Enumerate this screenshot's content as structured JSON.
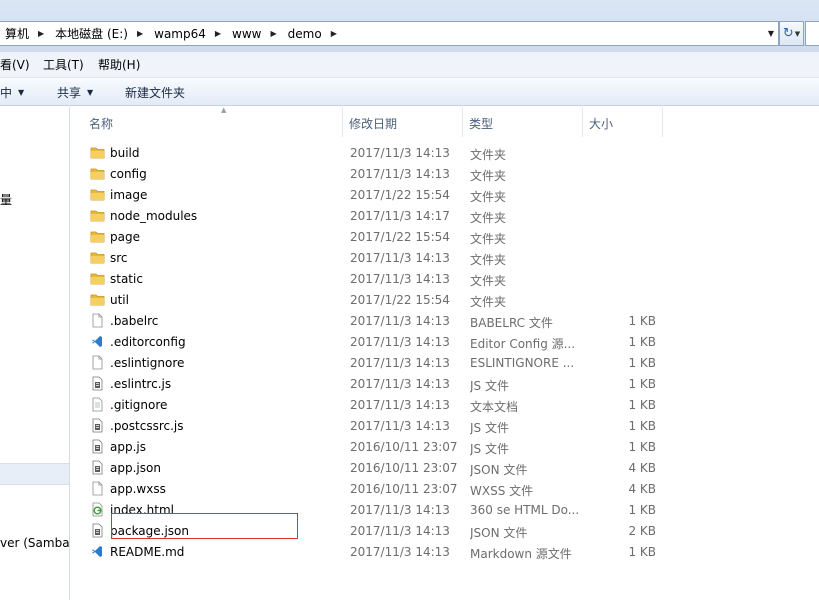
{
  "address_bar": {
    "crumbs": [
      "算机",
      "本地磁盘 (E:)",
      "wamp64",
      "www",
      "demo"
    ]
  },
  "menu": {
    "items": [
      "看(V)",
      "工具(T)",
      "帮助(H)"
    ]
  },
  "commands": {
    "include_in_library": "中",
    "share": "共享",
    "new_folder": "新建文件夹"
  },
  "nav": {
    "item_mid": "量",
    "item_network": "ver (Samba S"
  },
  "columns": {
    "name": "名称",
    "date": "修改日期",
    "type": "类型",
    "size": "大小"
  },
  "files": [
    {
      "name": "build",
      "date": "2017/11/3 14:13",
      "type": "文件夹",
      "size": "",
      "icon": "folder-icon"
    },
    {
      "name": "config",
      "date": "2017/11/3 14:13",
      "type": "文件夹",
      "size": "",
      "icon": "folder-icon"
    },
    {
      "name": "image",
      "date": "2017/1/22 15:54",
      "type": "文件夹",
      "size": "",
      "icon": "folder-icon"
    },
    {
      "name": "node_modules",
      "date": "2017/11/3 14:17",
      "type": "文件夹",
      "size": "",
      "icon": "folder-icon"
    },
    {
      "name": "page",
      "date": "2017/1/22 15:54",
      "type": "文件夹",
      "size": "",
      "icon": "folder-icon"
    },
    {
      "name": "src",
      "date": "2017/11/3 14:13",
      "type": "文件夹",
      "size": "",
      "icon": "folder-icon"
    },
    {
      "name": "static",
      "date": "2017/11/3 14:13",
      "type": "文件夹",
      "size": "",
      "icon": "folder-icon"
    },
    {
      "name": "util",
      "date": "2017/1/22 15:54",
      "type": "文件夹",
      "size": "",
      "icon": "folder-icon"
    },
    {
      "name": ".babelrc",
      "date": "2017/11/3 14:13",
      "type": "BABELRC 文件",
      "size": "1 KB",
      "icon": "blank-file-icon"
    },
    {
      "name": ".editorconfig",
      "date": "2017/11/3 14:13",
      "type": "Editor Config 源...",
      "size": "1 KB",
      "icon": "vscode-file-icon"
    },
    {
      "name": ".eslintignore",
      "date": "2017/11/3 14:13",
      "type": "ESLINTIGNORE ...",
      "size": "1 KB",
      "icon": "blank-file-icon"
    },
    {
      "name": ".eslintrc.js",
      "date": "2017/11/3 14:13",
      "type": "JS 文件",
      "size": "1 KB",
      "icon": "script-file-icon"
    },
    {
      "name": ".gitignore",
      "date": "2017/11/3 14:13",
      "type": "文本文档",
      "size": "1 KB",
      "icon": "text-file-icon"
    },
    {
      "name": ".postcssrc.js",
      "date": "2017/11/3 14:13",
      "type": "JS 文件",
      "size": "1 KB",
      "icon": "script-file-icon"
    },
    {
      "name": "app.js",
      "date": "2016/10/11 23:07",
      "type": "JS 文件",
      "size": "1 KB",
      "icon": "script-file-icon"
    },
    {
      "name": "app.json",
      "date": "2016/10/11 23:07",
      "type": "JSON 文件",
      "size": "4 KB",
      "icon": "script-file-icon"
    },
    {
      "name": "app.wxss",
      "date": "2016/10/11 23:07",
      "type": "WXSS 文件",
      "size": "4 KB",
      "icon": "blank-file-icon"
    },
    {
      "name": "index.html",
      "date": "2017/11/3 14:13",
      "type": "360 se HTML Do...",
      "size": "1 KB",
      "icon": "html-file-icon"
    },
    {
      "name": "package.json",
      "date": "2017/11/3 14:13",
      "type": "JSON 文件",
      "size": "2 KB",
      "icon": "script-file-icon"
    },
    {
      "name": "README.md",
      "date": "2017/11/3 14:13",
      "type": "Markdown 源文件",
      "size": "1 KB",
      "icon": "vscode-file-icon"
    }
  ],
  "colors": {
    "highlight_box": "#e03030",
    "folder": "#e8b83a",
    "accent": "#2b63b0"
  }
}
